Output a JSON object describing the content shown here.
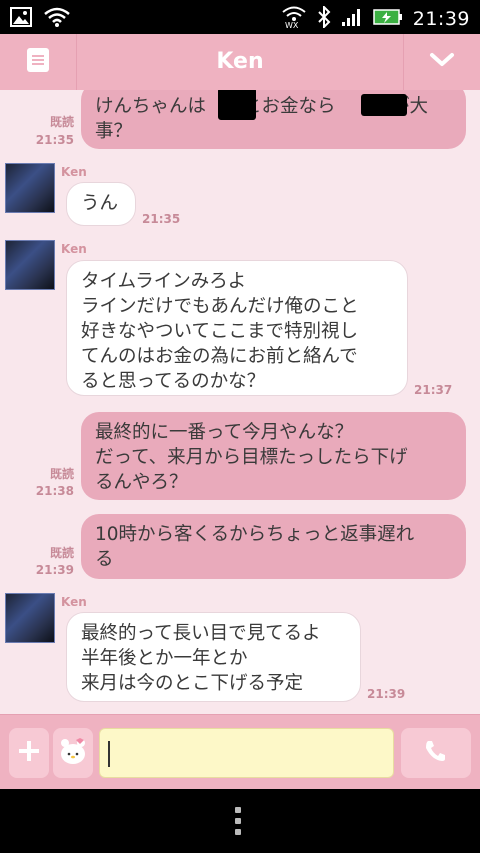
{
  "status_bar": {
    "time": "21:39"
  },
  "header": {
    "title": "Ken"
  },
  "messages": [
    {
      "dir": "out",
      "text": "けんちゃんは　　とお金なら　　　が大\n事？",
      "read": "既読",
      "time": "21:35"
    },
    {
      "dir": "in",
      "sender": "Ken",
      "text": "うん",
      "time": "21:35"
    },
    {
      "dir": "in",
      "sender": "Ken",
      "text": "タイムラインみろよ\nラインだけでもあんだけ俺のこと\n好きなやついてここまで特別視し\nてんのはお金の為にお前と絡んで\nると思ってるのかな？",
      "time": "21:37"
    },
    {
      "dir": "out",
      "text": "最終的に一番って今月やんな？\nだって、来月から目標たっしたら下げ\nるんやろ？",
      "read": "既読",
      "time": "21:38"
    },
    {
      "dir": "out",
      "text": "10時から客くるからちょっと返事遅れ\nる",
      "read": "既読",
      "time": "21:39"
    },
    {
      "dir": "in",
      "sender": "Ken",
      "text": "最終的って長い目で見てるよ\n半年後とか一年とか\n来月は今のとこ下げる予定",
      "time": "21:39"
    }
  ],
  "input": {
    "value": "",
    "placeholder": ""
  },
  "icons": {
    "menu": "menu-icon",
    "dropdown": "chevron-down-icon",
    "add": "plus-icon",
    "sticker": "sticker-icon",
    "call": "phone-icon",
    "overflow": "more-vert-icon"
  },
  "colors": {
    "header": "#efb2c1",
    "chat_bg": "#f9e7ec",
    "outgoing": "#e9aabb",
    "incoming": "#ffffff",
    "input_field": "#fdf8c8"
  }
}
